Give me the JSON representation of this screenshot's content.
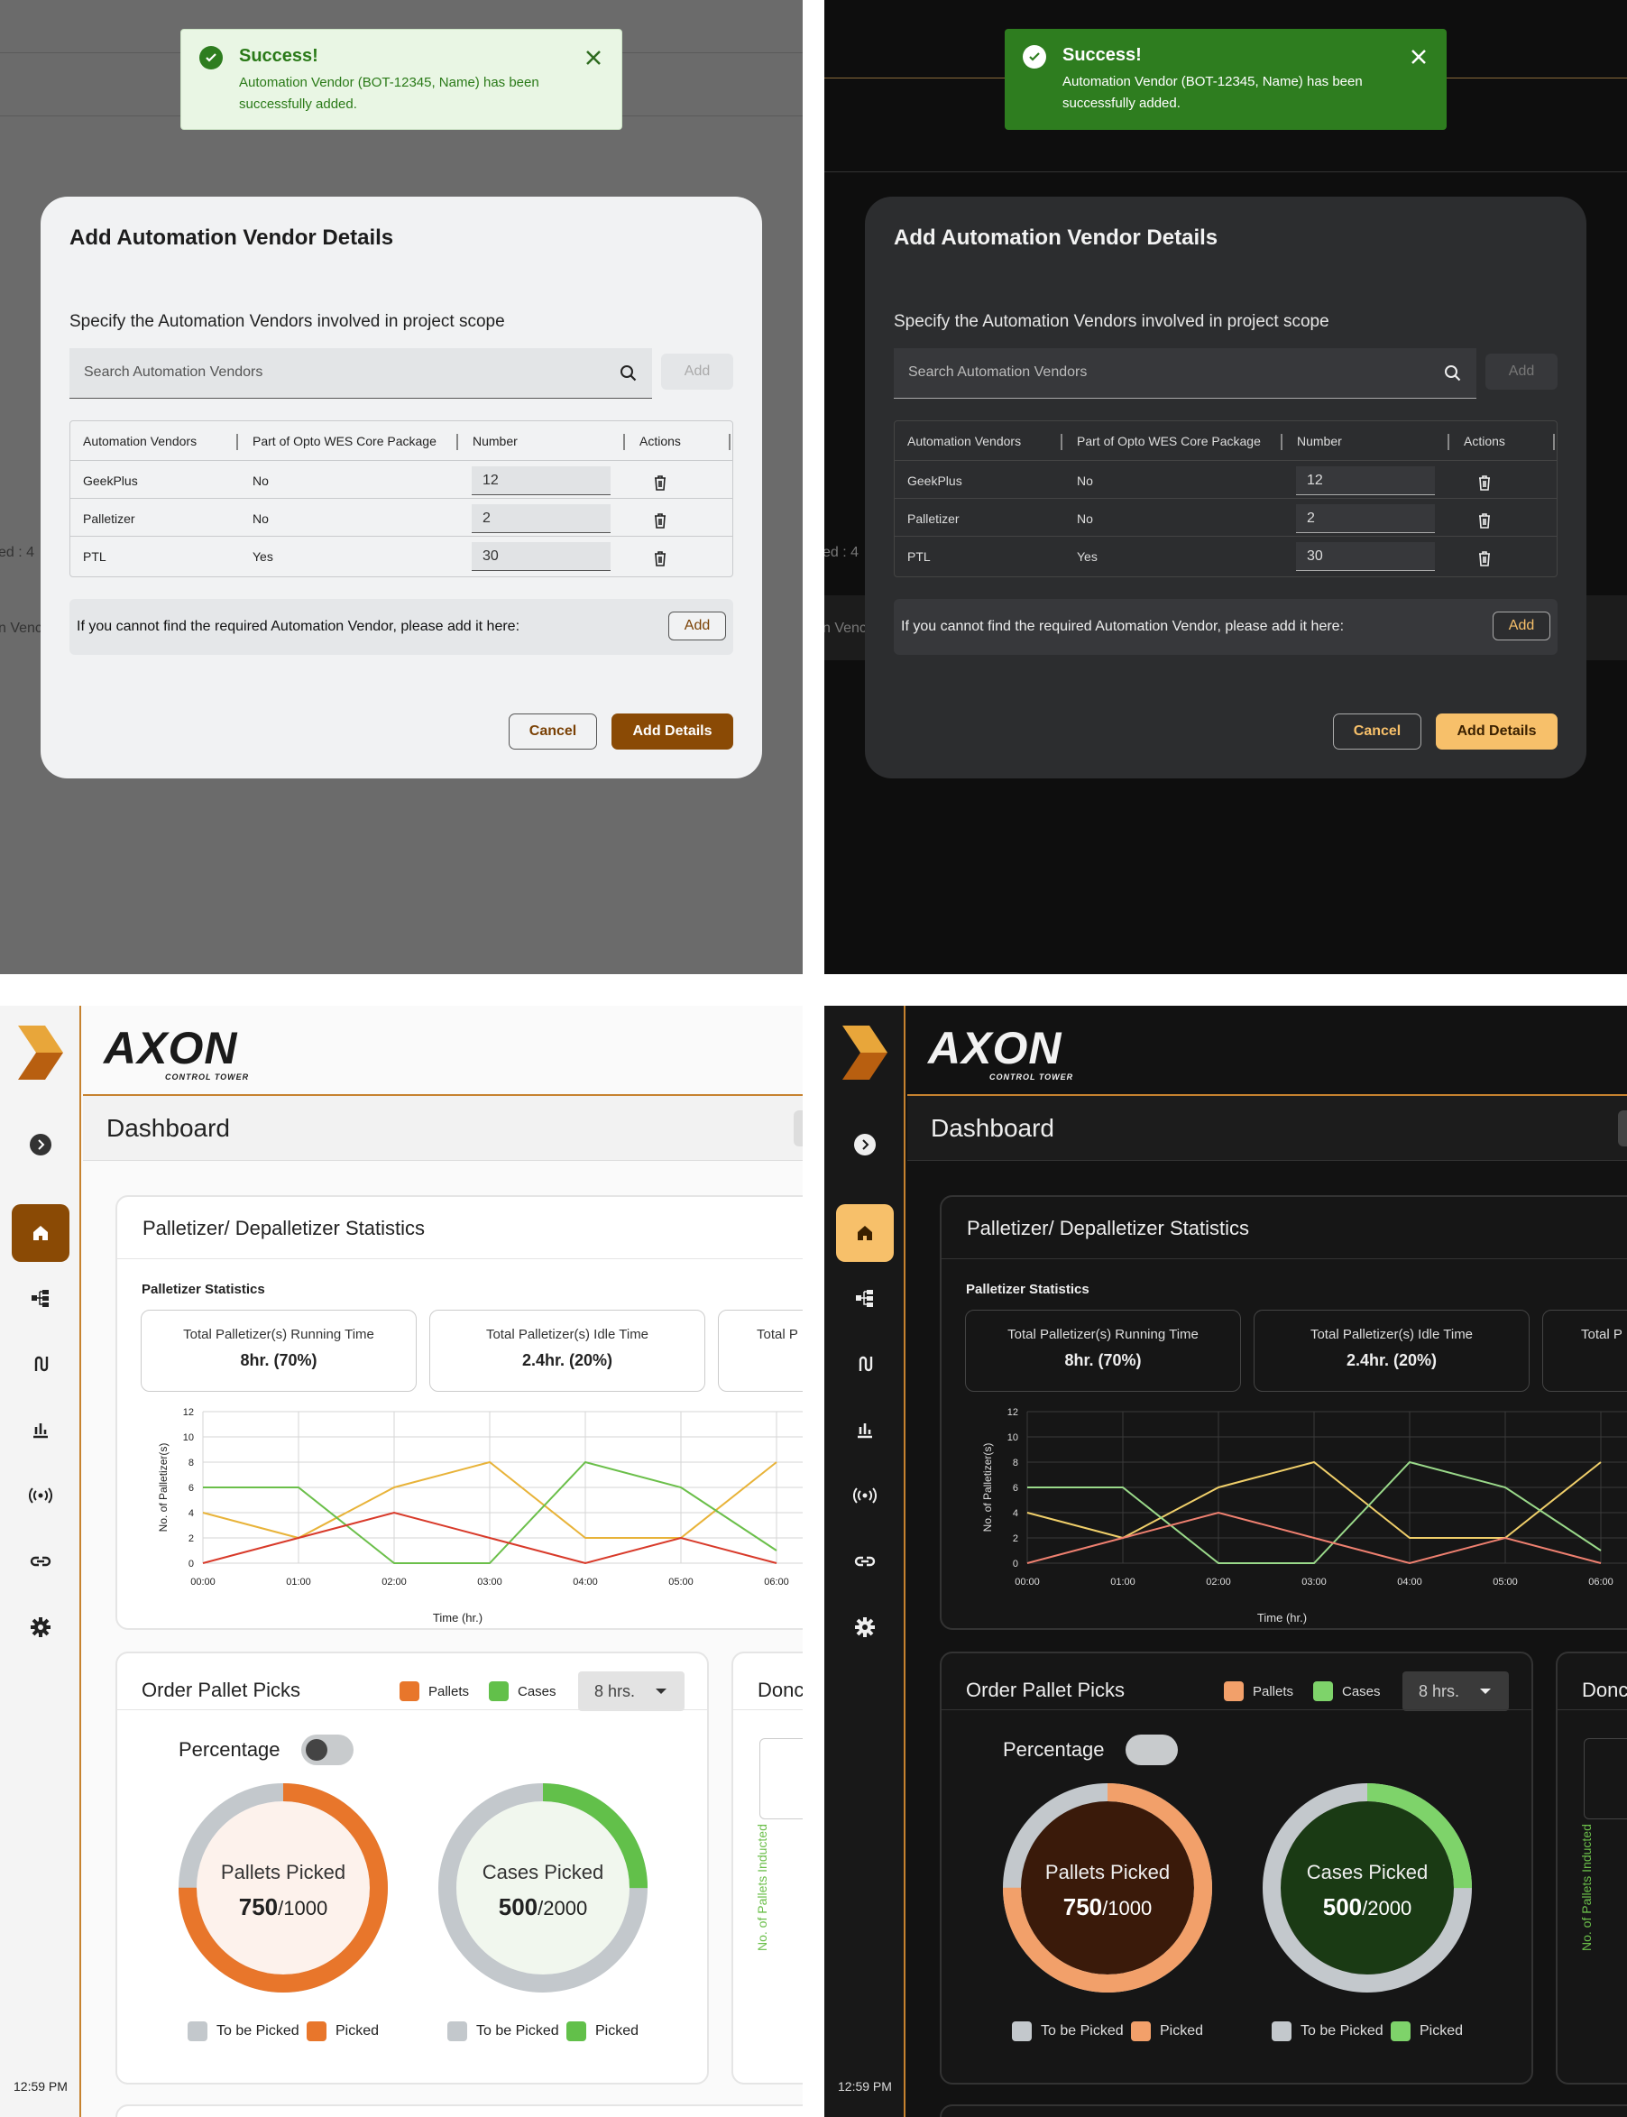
{
  "toast": {
    "title": "Success!",
    "message": "Automation Vendor (BOT-12345, Name) has been successfully added."
  },
  "modal": {
    "title": "Add Automation Vendor Details",
    "subtitle": "Specify the Automation Vendors involved in project scope",
    "search_placeholder": "Search Automation Vendors",
    "add_label": "Add",
    "columns": [
      "Automation Vendors",
      "Part of Opto WES Core Package",
      "Number",
      "Actions"
    ],
    "rows": [
      {
        "vendor": "GeekPlus",
        "core": "No",
        "number": "12"
      },
      {
        "vendor": "Palletizer",
        "core": "No",
        "number": "2"
      },
      {
        "vendor": "PTL",
        "core": "Yes",
        "number": "30"
      }
    ],
    "footer_text": "If you cannot find the required Automation Vendor, please add it here:",
    "footer_add": "Add",
    "cancel": "Cancel",
    "add_details": "Add Details"
  },
  "bg_fragments": {
    "left1": "ed : 4",
    "left2": "n Venc"
  },
  "dashboard": {
    "brand": "AXON",
    "brand_sub": "CONTROL TOWER",
    "title": "Dashboard",
    "time": "12:59 PM",
    "card_title": "Palletizer/ Depalletizer Statistics",
    "section_label": "Palletizer Statistics",
    "stats": [
      {
        "label": "Total Palletizer(s) Running Time",
        "value": "8hr. (70%)"
      },
      {
        "label": "Total Palletizer(s) Idle Time",
        "value": "2.4hr. (20%)"
      },
      {
        "label": "Total P",
        "value": ""
      }
    ],
    "orders": {
      "title": "Order Pallet Picks",
      "legend": [
        "Pallets",
        "Cases"
      ],
      "dropdown": "8 hrs.",
      "percentage": "Percentage",
      "pallets": {
        "label": "Pallets Picked",
        "picked": "750",
        "total": "/1000",
        "fraction": 0.75
      },
      "cases": {
        "label": "Cases Picked",
        "picked": "500",
        "total": "/2000",
        "fraction": 0.25
      },
      "ring_legend": [
        "To be Picked",
        "Picked"
      ]
    },
    "card3": {
      "title": "Donc",
      "ylabel": "No. of Pallets Inducted"
    }
  },
  "chart_data": {
    "type": "line",
    "x": [
      "00:00",
      "01:00",
      "02:00",
      "03:00",
      "04:00",
      "05:00",
      "06:00"
    ],
    "xlabel": "Time (hr.)",
    "ylabel": "No. of Palletizer(s)",
    "ylim": [
      0,
      12
    ],
    "yticks": [
      0,
      2,
      4,
      6,
      8,
      10,
      12
    ],
    "series": [
      {
        "color": "#e8b339",
        "values": [
          4,
          2,
          6,
          8,
          2,
          2,
          8
        ]
      },
      {
        "color": "#6bbf4a",
        "values": [
          6,
          6,
          0,
          0,
          8,
          6,
          1
        ]
      },
      {
        "color": "#d83a2a",
        "values": [
          0,
          2,
          4,
          2,
          0,
          2,
          0
        ]
      }
    ],
    "grid": true
  },
  "colors": {
    "brand_orange": "#d17b1f",
    "brown": "#8a4a05",
    "gold": "#f7c06a",
    "orange": "#e8762b",
    "green": "#62c04a"
  }
}
